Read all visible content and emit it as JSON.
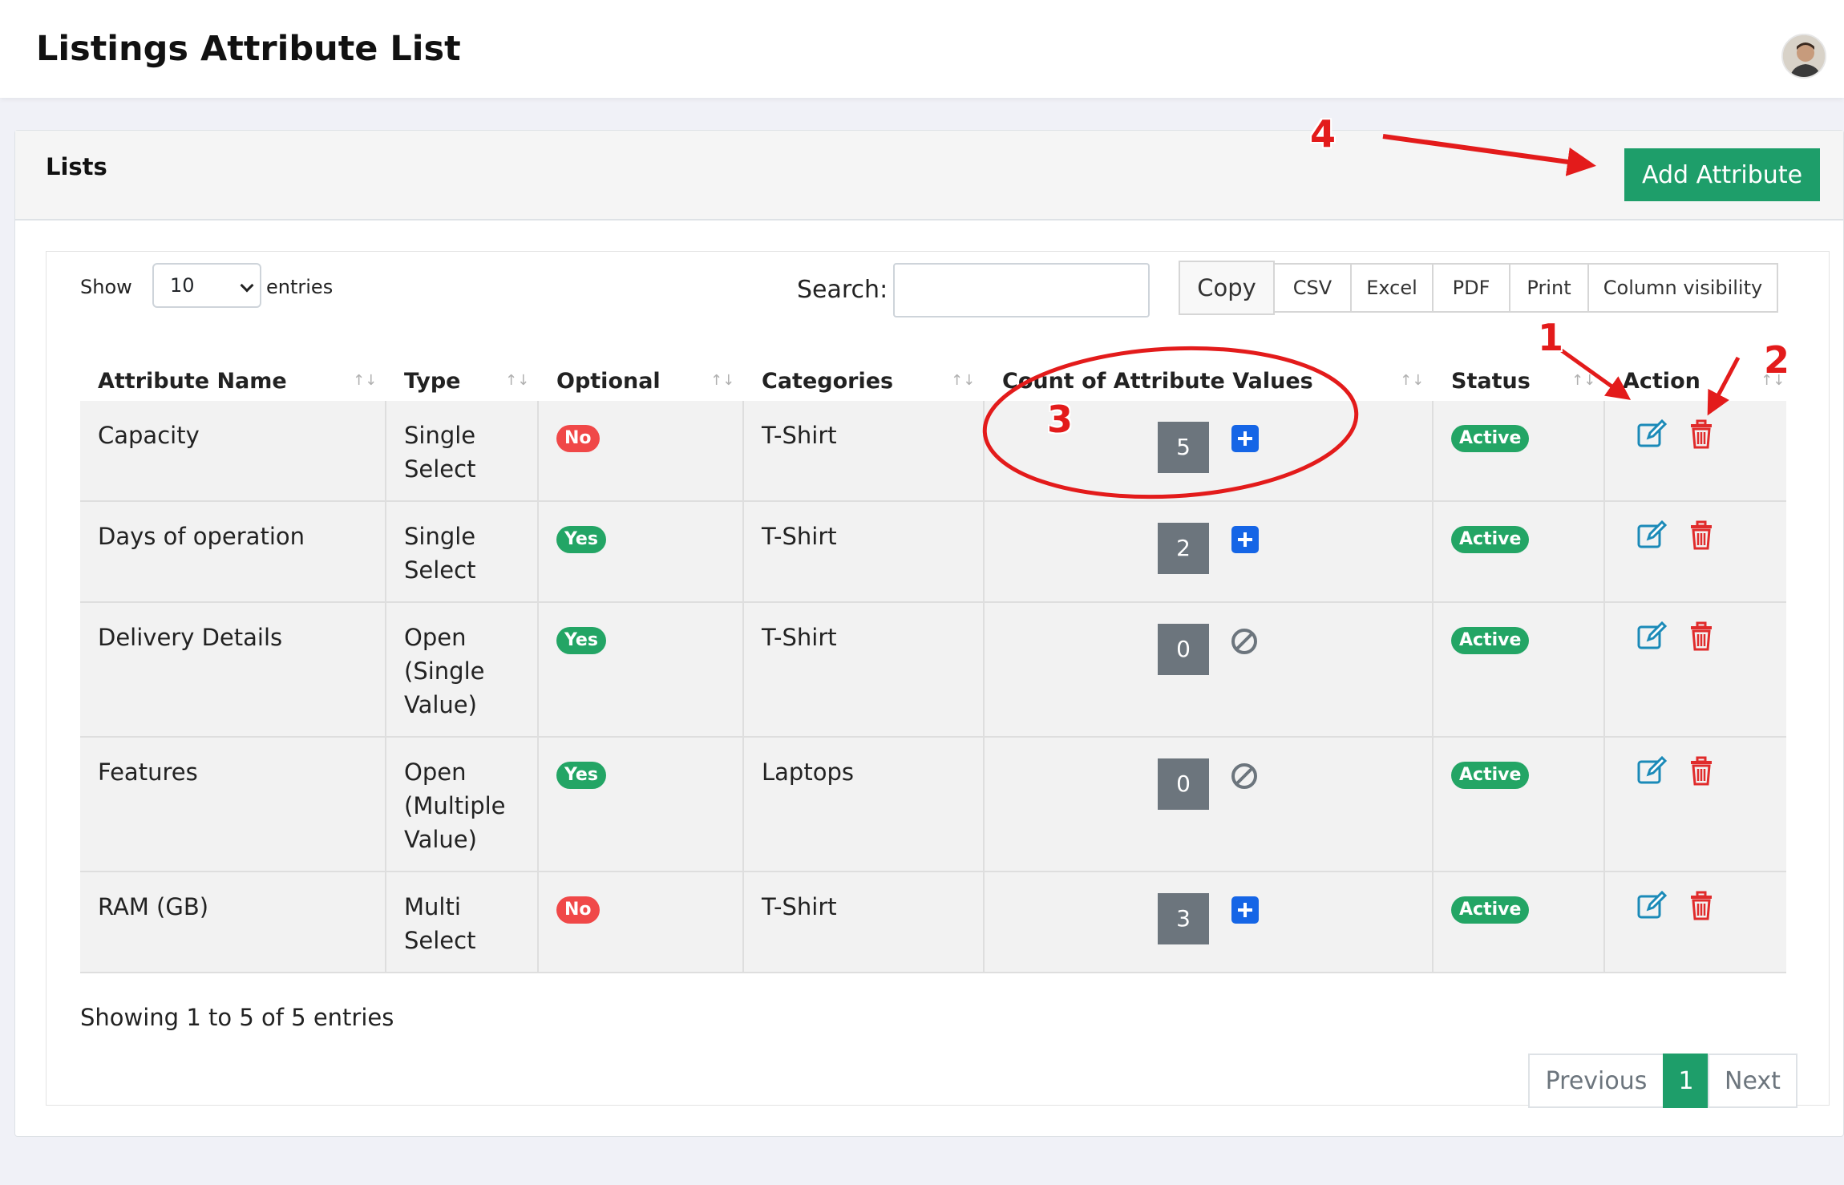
{
  "header": {
    "title": "Listings Attribute List"
  },
  "card": {
    "title": "Lists",
    "add_button": "Add Attribute"
  },
  "controls": {
    "show_label": "Show",
    "page_size": "10",
    "entries_label": "entries",
    "search_label": "Search:",
    "search_value": "",
    "buttons": [
      "Copy",
      "CSV",
      "Excel",
      "PDF",
      "Print",
      "Column visibility"
    ]
  },
  "table": {
    "columns": [
      "Attribute Name",
      "Type",
      "Optional",
      "Categories",
      "Count of Attribute Values",
      "Status",
      "Action"
    ],
    "rows": [
      {
        "name": "Capacity",
        "type": "Single Select",
        "optional": "No",
        "category": "T-Shirt",
        "count": "5",
        "count_icon": "plus-square-icon",
        "status": "Active"
      },
      {
        "name": "Days of operation",
        "type": "Single Select",
        "optional": "Yes",
        "category": "T-Shirt",
        "count": "2",
        "count_icon": "plus-square-icon",
        "status": "Active"
      },
      {
        "name": "Delivery Details",
        "type": "Open (Single Value)",
        "optional": "Yes",
        "category": "T-Shirt",
        "count": "0",
        "count_icon": "ban-icon",
        "status": "Active"
      },
      {
        "name": "Features",
        "type": "Open (Multiple Value)",
        "optional": "Yes",
        "category": "Laptops",
        "count": "0",
        "count_icon": "ban-icon",
        "status": "Active"
      },
      {
        "name": "RAM (GB)",
        "type": "Multi Select",
        "optional": "No",
        "category": "T-Shirt",
        "count": "3",
        "count_icon": "plus-square-icon",
        "status": "Active"
      }
    ]
  },
  "footer": {
    "showing": "Showing 1 to 5 of 5 entries",
    "prev": "Previous",
    "page": "1",
    "next": "Next"
  },
  "annotations": {
    "markers": [
      "1",
      "2",
      "3",
      "4"
    ],
    "color": "#e31b1b"
  },
  "colors": {
    "primary_green": "#1e9e6a",
    "danger": "#f04848",
    "blue": "#1565e6",
    "edit_icon": "#1b8ab8",
    "delete_icon": "#e02b2b"
  }
}
